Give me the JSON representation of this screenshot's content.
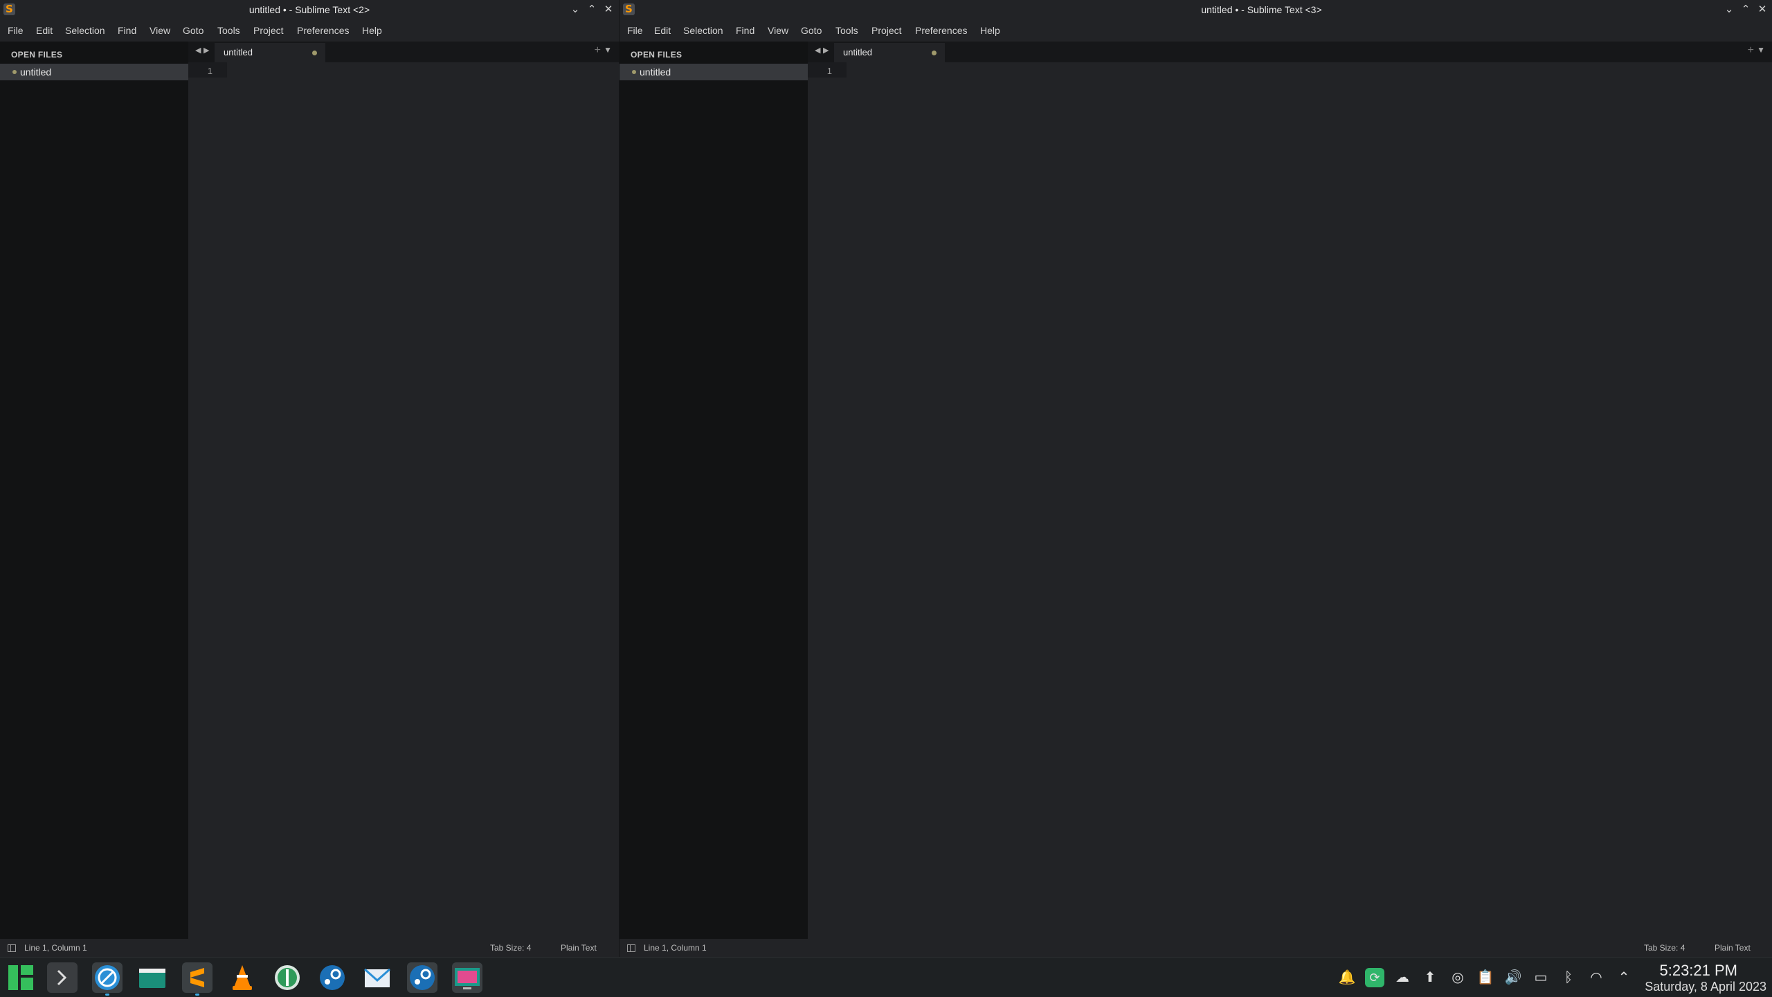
{
  "windows": [
    {
      "title": "untitled • - Sublime Text <2>",
      "menu": [
        "File",
        "Edit",
        "Selection",
        "Find",
        "View",
        "Goto",
        "Tools",
        "Project",
        "Preferences",
        "Help"
      ],
      "sidebar": {
        "header": "OPEN FILES",
        "files": [
          "untitled"
        ]
      },
      "tab": {
        "label": "untitled"
      },
      "line_number": "1",
      "status": {
        "position": "Line 1, Column 1",
        "tab_size": "Tab Size: 4",
        "syntax": "Plain Text"
      }
    },
    {
      "title": "untitled • - Sublime Text <3>",
      "menu": [
        "File",
        "Edit",
        "Selection",
        "Find",
        "View",
        "Goto",
        "Tools",
        "Project",
        "Preferences",
        "Help"
      ],
      "sidebar": {
        "header": "OPEN FILES",
        "files": [
          "untitled"
        ]
      },
      "tab": {
        "label": "untitled"
      },
      "line_number": "1",
      "status": {
        "position": "Line 1, Column 1",
        "tab_size": "Tab Size: 4",
        "syntax": "Plain Text"
      }
    }
  ],
  "taskbar": {
    "apps": [
      "manjaro-logo-icon",
      "terminal-icon",
      "browser-icon",
      "file-manager-icon",
      "sublime-text-icon",
      "vlc-icon",
      "qbittorrent-icon",
      "steam-icon",
      "mail-icon",
      "steam-icon",
      "screenshot-icon"
    ],
    "tray": [
      "notification-bell-icon",
      "sync-icon",
      "cloud-icon",
      "update-icon",
      "steam-tray-icon",
      "clipboard-icon",
      "volume-icon",
      "battery-icon",
      "bluetooth-icon",
      "wifi-icon",
      "chevron-up-icon"
    ],
    "clock": {
      "time": "5:23:21 PM",
      "date": "Saturday, 8 April 2023"
    }
  },
  "colors": {
    "accent": "#3daee9",
    "dirty_dot": "#a09a6c",
    "sublime_orange": "#ff9800"
  }
}
